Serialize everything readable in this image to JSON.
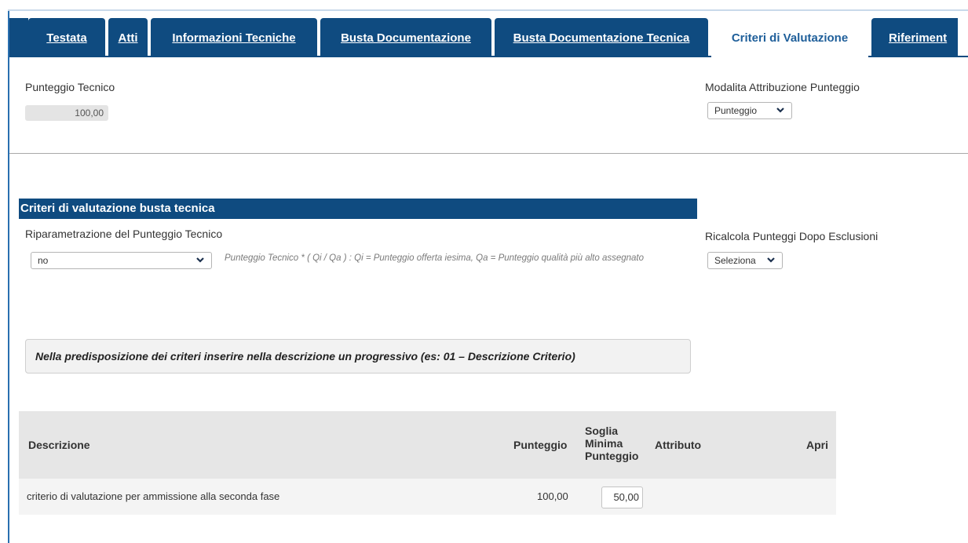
{
  "tabs": [
    {
      "label": "Testata",
      "active": false
    },
    {
      "label": "Atti",
      "active": false
    },
    {
      "label": "Informazioni Tecniche",
      "active": false
    },
    {
      "label": "Busta Documentazione",
      "active": false
    },
    {
      "label": "Busta Documentazione Tecnica",
      "active": false
    },
    {
      "label": "Criteri di Valutazione",
      "active": true
    },
    {
      "label": "Riferiment",
      "active": false
    }
  ],
  "punteggio_tecnico": {
    "label": "Punteggio Tecnico",
    "value": "100,00"
  },
  "modalita": {
    "label": "Modalita Attribuzione Punteggio",
    "selected": "Punteggio"
  },
  "section": {
    "title": "Criteri di valutazione busta tecnica"
  },
  "riparametrazione": {
    "label": "Riparametrazione del Punteggio Tecnico",
    "selected": "no",
    "hint": "Punteggio Tecnico * ( Qi / Qa ) : Qi = Punteggio offerta iesima, Qa = Punteggio qualità più alto assegnato"
  },
  "ricalcola": {
    "label": "Ricalcola Punteggi Dopo Esclusioni",
    "selected": "Seleziona"
  },
  "note": "Nella predisposizione dei criteri inserire nella descrizione un progressivo (es: 01 – Descrizione Criterio)",
  "table": {
    "headers": {
      "descrizione": "Descrizione",
      "punteggio": "Punteggio",
      "soglia_line1": "Soglia",
      "soglia_line2": "Minima",
      "soglia_line3": "Punteggio",
      "attributo": "Attributo",
      "apri": "Apri"
    },
    "rows": [
      {
        "descrizione": "criterio di valutazione per ammissione alla seconda fase",
        "punteggio": "100,00",
        "soglia": "50,00"
      }
    ]
  },
  "colors": {
    "primary": "#0f4b80",
    "active_tab_text": "#1f5f9a"
  }
}
